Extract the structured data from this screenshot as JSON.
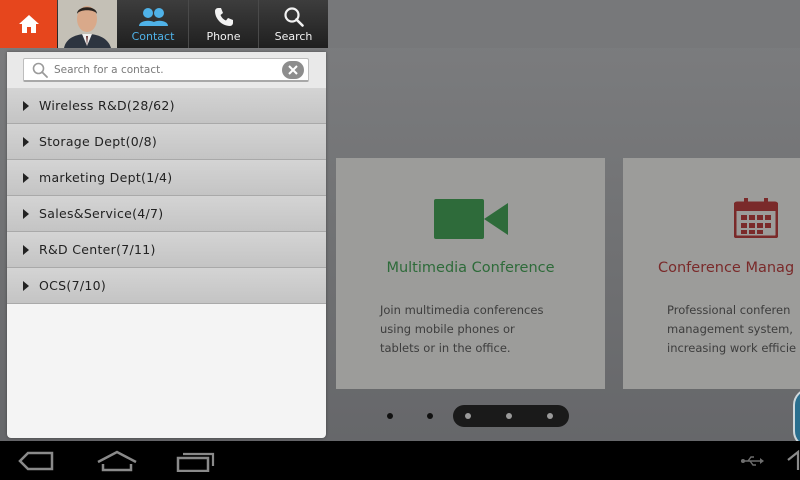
{
  "topbar": {
    "tabs": [
      {
        "label": "Contact",
        "icon": "people-icon",
        "active": true
      },
      {
        "label": "Phone",
        "icon": "phone-icon"
      },
      {
        "label": "Search",
        "icon": "search-icon"
      }
    ]
  },
  "contact_panel": {
    "search": {
      "placeholder": "Search for a contact.",
      "value": ""
    },
    "groups": [
      {
        "label": "Wireless R&D(28/62)"
      },
      {
        "label": "Storage Dept(0/8)"
      },
      {
        "label": "marketing Dept(1/4)"
      },
      {
        "label": "Sales&Service(4/7)"
      },
      {
        "label": "R&D Center(7/11)"
      },
      {
        "label": "OCS(7/10)"
      }
    ]
  },
  "cards": [
    {
      "title": "Multimedia Conference",
      "icon": "video-camera-icon",
      "color": "#2e6b3a",
      "description": [
        "Join multimedia conferences",
        "using mobile phones or",
        "tablets or in the office."
      ]
    },
    {
      "title": "Conference Manag",
      "icon": "calendar-icon",
      "color": "#7a2a2a",
      "description": [
        "Professional conferen",
        "management system,",
        "increasing work efficie"
      ]
    }
  ],
  "pager": {
    "count": 5,
    "active_range": [
      2,
      4
    ]
  },
  "colors": {
    "accent_home": "#e6461d",
    "active_tab": "#4fb2e8"
  }
}
